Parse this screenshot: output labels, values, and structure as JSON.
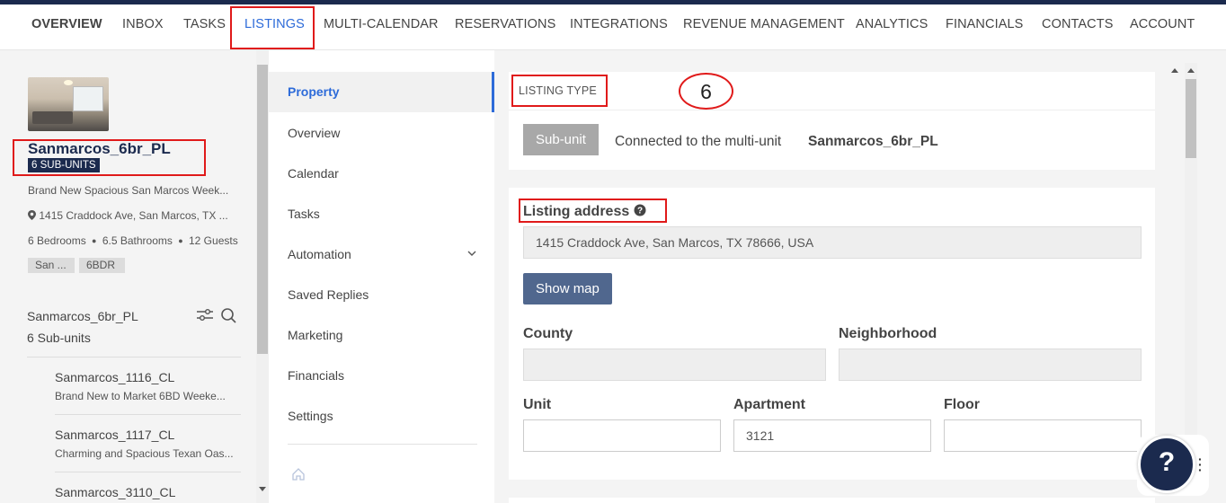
{
  "nav": {
    "items": [
      "OVERVIEW",
      "INBOX",
      "TASKS",
      "LISTINGS",
      "MULTI-CALENDAR",
      "RESERVATIONS",
      "INTEGRATIONS",
      "REVENUE MANAGEMENT",
      "ANALYTICS",
      "FINANCIALS",
      "CONTACTS",
      "ACCOUNT"
    ],
    "active": "LISTINGS"
  },
  "property": {
    "name": "Sanmarcos_6br_PL",
    "badge": "6 SUB-UNITS",
    "description": "Brand New Spacious San Marcos Week...",
    "address": "1415 Craddock Ave, San Marcos, TX ...",
    "bedrooms": "6 Bedrooms",
    "bathrooms": "6.5 Bathrooms",
    "guests": "12 Guests",
    "tags": [
      "San ...",
      "6BDR"
    ]
  },
  "sublist": {
    "title": "Sanmarcos_6br_PL",
    "count": "6 Sub-units",
    "items": [
      {
        "name": "Sanmarcos_1116_CL",
        "desc": "Brand New to Market 6BD Weeke..."
      },
      {
        "name": "Sanmarcos_1117_CL",
        "desc": "Charming and Spacious Texan Oas..."
      },
      {
        "name": "Sanmarcos_3110_CL",
        "desc": ""
      }
    ]
  },
  "menu": {
    "items": [
      "Property",
      "Overview",
      "Calendar",
      "Tasks",
      "Automation",
      "Saved Replies",
      "Marketing",
      "Financials",
      "Settings"
    ],
    "active": "Property"
  },
  "listing_type": {
    "header": "LISTING TYPE",
    "annotation": "6",
    "button": "Sub-unit",
    "connected_text": "Connected to the multi-unit",
    "connected_name": "Sanmarcos_6br_PL"
  },
  "address": {
    "label": "Listing address",
    "value": "1415 Craddock Ave, San Marcos, TX 78666, USA",
    "show_map": "Show map",
    "county_label": "County",
    "county_value": "",
    "neighborhood_label": "Neighborhood",
    "neighborhood_value": "",
    "unit_label": "Unit",
    "unit_value": "",
    "apartment_label": "Apartment",
    "apartment_value": "3121",
    "floor_label": "Floor",
    "floor_value": ""
  },
  "help": {
    "label": "?"
  },
  "colors": {
    "brand": "#1b2a4e",
    "accent": "#2d6bd9",
    "highlight": "#e01a1a"
  }
}
